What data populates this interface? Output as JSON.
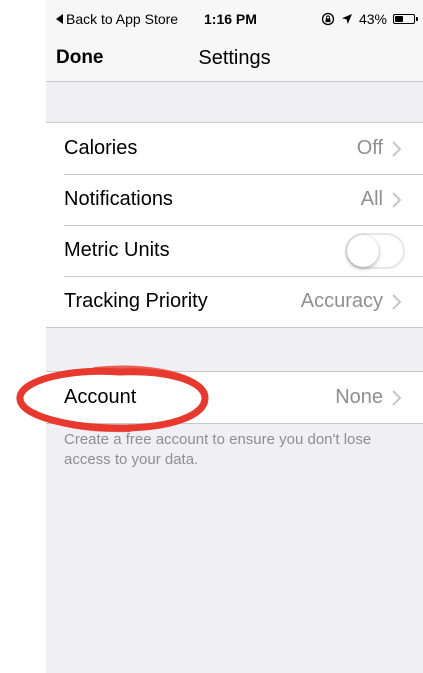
{
  "status_bar": {
    "back_label": "Back to App Store",
    "time": "1:16 PM",
    "battery_text": "43%",
    "battery_level": 0.43,
    "icons": [
      "back-arrow-icon",
      "orientation-lock-icon",
      "location-arrow-icon",
      "battery-icon"
    ]
  },
  "nav": {
    "done_label": "Done",
    "title": "Settings"
  },
  "settings": {
    "rows": [
      {
        "label": "Calories",
        "value": "Off",
        "control": "disclosure"
      },
      {
        "label": "Notifications",
        "value": "All",
        "control": "disclosure"
      },
      {
        "label": "Metric Units",
        "value": "",
        "control": "toggle",
        "on": false
      },
      {
        "label": "Tracking Priority",
        "value": "Accuracy",
        "control": "disclosure"
      }
    ]
  },
  "account": {
    "label": "Account",
    "value": "None",
    "footer": "Create a free account to ensure you don't lose access to your data."
  },
  "colors": {
    "background": "#efeff4",
    "separator": "#c8c7cc",
    "secondary_text": "#8e8e93",
    "annotation": "#e8392e"
  }
}
